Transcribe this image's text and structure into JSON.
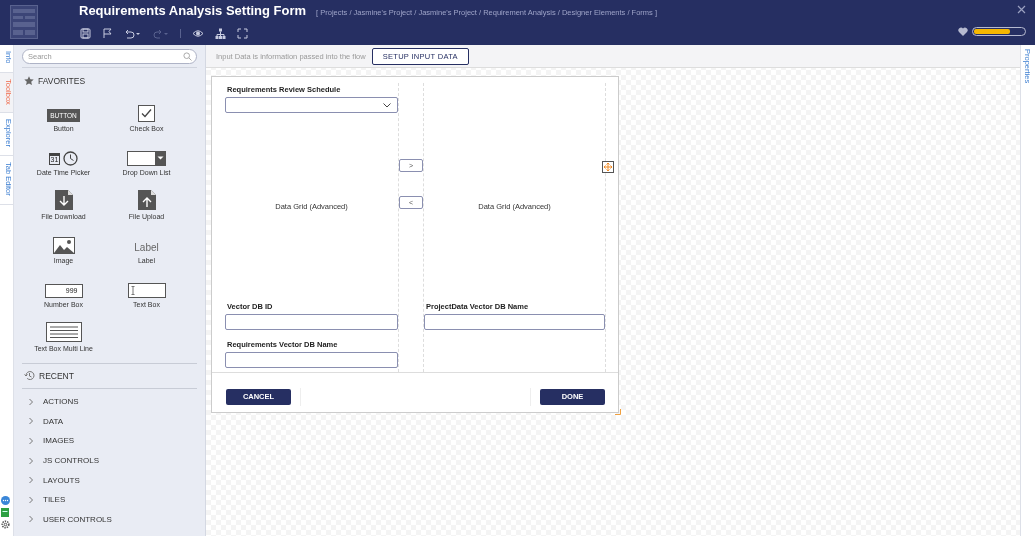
{
  "window": {
    "title": "Requirements Analysis Setting Form",
    "breadcrumb": "[ Projects / Jasmine's Project / Jasmine's Project / Requirement Analysis / Designer Elements / Forms ]",
    "progress": {
      "level": 0.72
    }
  },
  "left_tabs": [
    {
      "label": "Info",
      "selected": false
    },
    {
      "label": "Toolbox",
      "selected": true
    },
    {
      "label": "Explorer",
      "selected": false
    },
    {
      "label": "Tab Editor",
      "selected": false
    }
  ],
  "toolbox": {
    "search": {
      "placeholder": "Search"
    },
    "favorites_title": "FAVORITES",
    "favorite_rows": [
      [
        {
          "label": "Button",
          "kind": "button",
          "icon_text": "BUTTON"
        },
        {
          "label": "Check Box",
          "kind": "checkbox"
        }
      ],
      [
        {
          "label": "Date Time Picker",
          "kind": "datetime",
          "icon_text": "31"
        },
        {
          "label": "Drop Down List",
          "kind": "dropdown"
        }
      ],
      [
        {
          "label": "File Download",
          "kind": "download"
        },
        {
          "label": "File Upload",
          "kind": "upload"
        }
      ],
      [
        {
          "label": "Image",
          "kind": "image"
        },
        {
          "label": "Label",
          "kind": "label",
          "icon_text": "Label"
        }
      ],
      [
        {
          "label": "Number Box",
          "kind": "number",
          "icon_text": "999"
        },
        {
          "label": "Text Box",
          "kind": "textbox"
        }
      ],
      [
        {
          "label": "Text Box Multi Line",
          "kind": "multiline"
        }
      ]
    ],
    "recent_title": "RECENT",
    "categories": [
      {
        "label": "ACTIONS",
        "expanded": false
      },
      {
        "label": "DATA",
        "expanded": false
      },
      {
        "label": "IMAGES",
        "expanded": false
      },
      {
        "label": "JS CONTROLS",
        "expanded": false
      },
      {
        "label": "LAYOUTS",
        "expanded": false
      },
      {
        "label": "TILES",
        "expanded": false
      },
      {
        "label": "USER CONTROLS",
        "expanded": false
      }
    ]
  },
  "canvas": {
    "info_text": "Input Data is information passed into the flow",
    "setup_button": "SETUP INPUT DATA",
    "form": {
      "left": [
        {
          "kind": "dropdown",
          "label": "Requirements Review Schedule"
        },
        {
          "kind": "grid",
          "text": "Data Grid (Advanced)"
        },
        {
          "kind": "text",
          "label": "Vector DB ID"
        },
        {
          "kind": "text",
          "label": "Requirements Vector DB Name"
        }
      ],
      "middle_buttons": [
        ">",
        "<"
      ],
      "right": [
        {
          "kind": "grid",
          "text": "Data Grid (Advanced)"
        },
        {
          "kind": "text",
          "label": "ProjectData Vector DB Name"
        }
      ],
      "footer_buttons": [
        {
          "label": "CANCEL",
          "kind": "cancel"
        },
        {
          "label": "DONE",
          "kind": "done"
        }
      ]
    }
  },
  "right_tabs": [
    {
      "label": "Properties",
      "selected": false
    }
  ]
}
